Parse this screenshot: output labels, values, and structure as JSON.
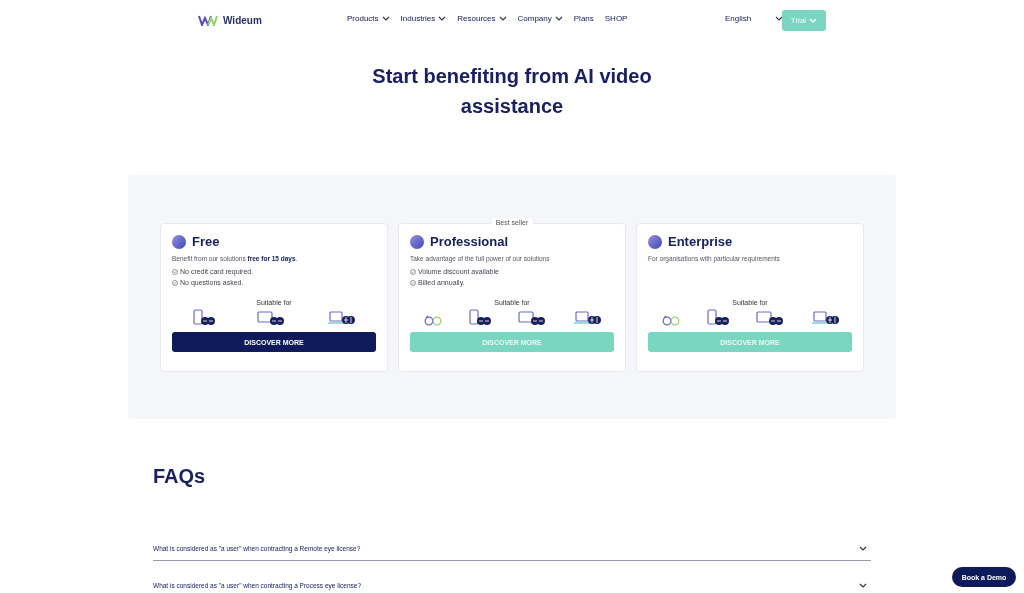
{
  "header": {
    "logo": "Wideum",
    "nav": [
      {
        "label": "Products",
        "dropdown": true
      },
      {
        "label": "Industries",
        "dropdown": true
      },
      {
        "label": "Resources",
        "dropdown": true
      },
      {
        "label": "Company",
        "dropdown": true
      },
      {
        "label": "Plans",
        "dropdown": false
      },
      {
        "label": "SHOP",
        "dropdown": false
      }
    ],
    "language": "English",
    "trial_button": "Trial"
  },
  "title": "Start benefiting from AI video assistance",
  "plans": [
    {
      "name": "Free",
      "description": "Benefit from our solutions **free for 15 days**.",
      "features": [
        "No credit card required.",
        "No questions asked."
      ],
      "suitable_label": "Suitable for",
      "devices": [
        {
          "kind": "tablet"
        },
        {
          "kind": "monitor"
        },
        {
          "kind": "laptop"
        }
      ],
      "button": {
        "label": "DISCOVER MORE",
        "kind": "dark"
      }
    },
    {
      "name": "Professional",
      "badge": "Best seller",
      "description": "Take advantage of the full power of our solutions",
      "features": [
        "Volume discount available",
        "Billed annually."
      ],
      "suitable_label": "Suitable for",
      "devices": [
        {
          "kind": "glasses"
        },
        {
          "kind": "tablet"
        },
        {
          "kind": "monitor"
        },
        {
          "kind": "laptop"
        }
      ],
      "button": {
        "label": "DISCOVER MORE",
        "kind": "light"
      }
    },
    {
      "name": "Enterprise",
      "description": "For organisations with particular requirements",
      "suitable_label": "Suitable for",
      "devices": [
        {
          "kind": "glasses"
        },
        {
          "kind": "tablet"
        },
        {
          "kind": "monitor"
        },
        {
          "kind": "laptop"
        }
      ],
      "button": {
        "label": "DISCOVER MORE",
        "kind": "light"
      }
    }
  ],
  "faq": {
    "heading": "FAQs",
    "items": [
      {
        "question": "What is considered as \"a user\" when contracting a Remote eye license?",
        "expanded": false
      },
      {
        "question": "What is considered as \"a user\" when contracting a Process eye license?",
        "expanded": false
      }
    ]
  },
  "book_demo_button": "Book a Demo"
}
